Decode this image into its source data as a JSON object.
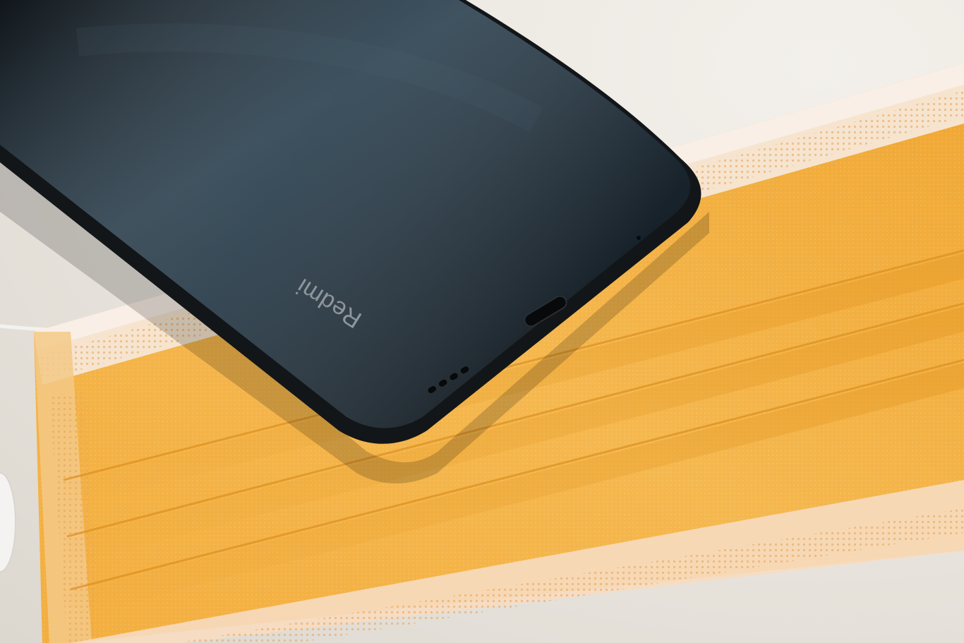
{
  "photo": {
    "subject": "phone-on-face-mask",
    "phone": {
      "brand_label": "Redmi",
      "body_color": "#1d2a33",
      "frame_color": "#15181b"
    },
    "mask": {
      "color": "#f2ad3c",
      "binding_color": "#f6e9dc"
    },
    "background_color": "#e8e4dd"
  }
}
